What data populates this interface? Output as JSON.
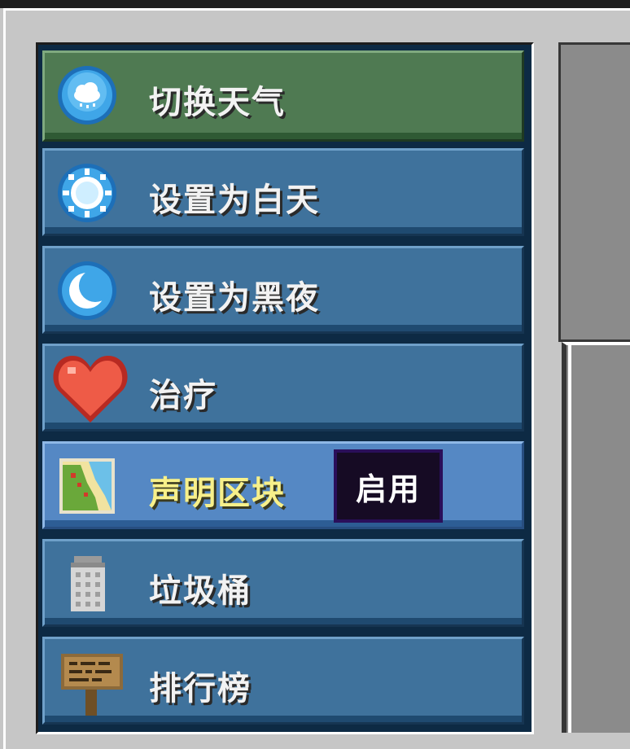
{
  "menu": {
    "items": [
      {
        "label": "切换天气",
        "icon": "weather-cloud-icon"
      },
      {
        "label": "设置为白天",
        "icon": "sun-icon"
      },
      {
        "label": "设置为黑夜",
        "icon": "moon-icon"
      },
      {
        "label": "治疗",
        "icon": "heart-icon"
      },
      {
        "label": "声明区块",
        "icon": "map-icon"
      },
      {
        "label": "垃圾桶",
        "icon": "trash-can-icon"
      },
      {
        "label": "排行榜",
        "icon": "signpost-icon"
      }
    ]
  },
  "tooltip": {
    "text": "启用"
  },
  "colors": {
    "active_item": "#4f7a52",
    "default_item": "#3f729c",
    "hover_item": "#5588c4",
    "hover_text": "#f7f08a",
    "tooltip_bg": "#160b24"
  }
}
